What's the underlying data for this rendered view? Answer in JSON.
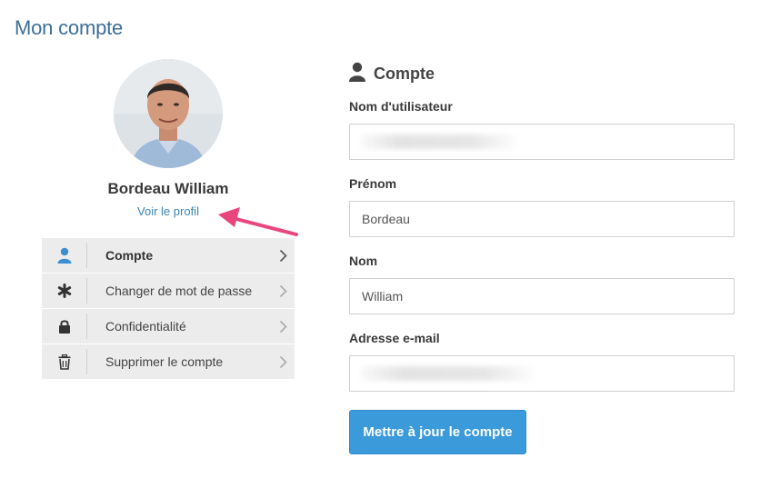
{
  "page": {
    "title": "Mon compte"
  },
  "profile": {
    "name": "Bordeau William",
    "view_profile_label": "Voir le profil"
  },
  "menu": {
    "items": [
      {
        "label": "Compte",
        "icon": "user-icon",
        "active": true
      },
      {
        "label": "Changer de mot de passe",
        "icon": "asterisk-icon",
        "active": false
      },
      {
        "label": "Confidentialité",
        "icon": "lock-icon",
        "active": false
      },
      {
        "label": "Supprimer le compte",
        "icon": "trash-icon",
        "active": false
      }
    ]
  },
  "account_form": {
    "title": "Compte",
    "username": {
      "label": "Nom d'utilisateur",
      "value": ""
    },
    "first_name": {
      "label": "Prénom",
      "value": "Bordeau"
    },
    "last_name": {
      "label": "Nom",
      "value": "William"
    },
    "email": {
      "label": "Adresse e-mail",
      "value": ""
    },
    "submit_label": "Mettre à jour le compte"
  },
  "colors": {
    "title": "#3d6f9a",
    "link": "#3a86b8",
    "active_icon": "#3b8fd0",
    "button": "#3b9ad9",
    "annotation_arrow": "#e8467c"
  }
}
